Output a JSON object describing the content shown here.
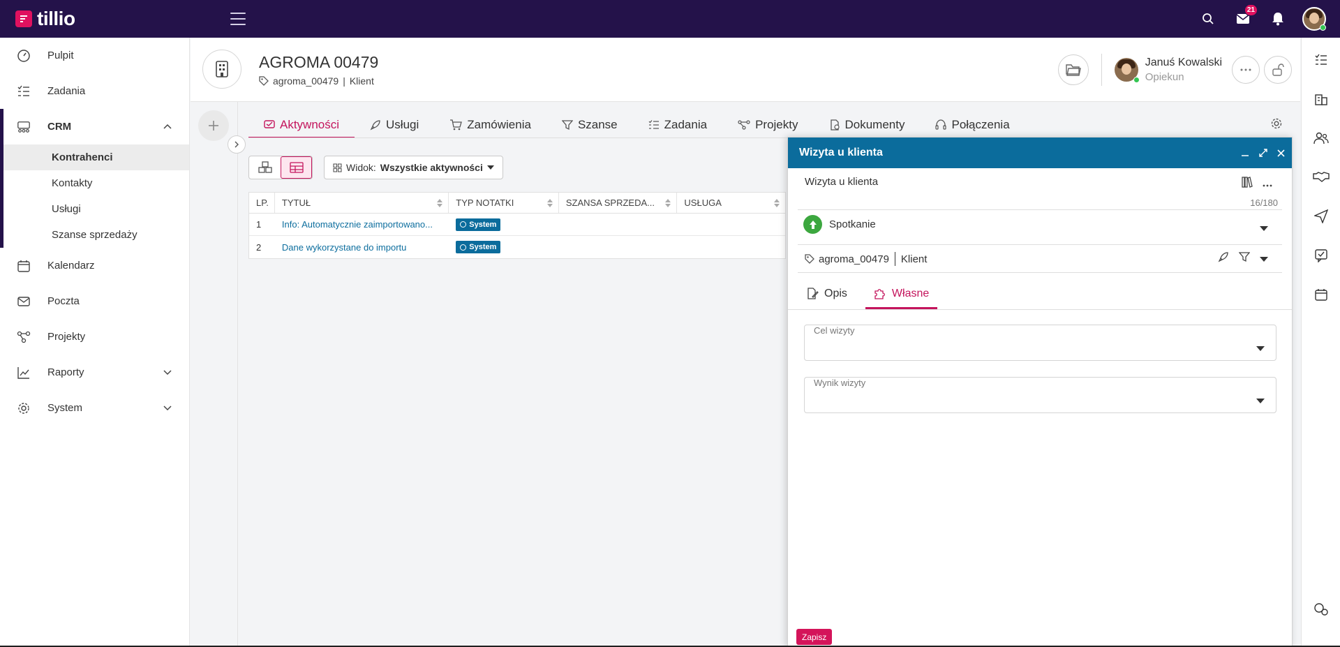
{
  "app": {
    "name": "tillio",
    "notifications_count": "21"
  },
  "sidebar": {
    "items": [
      {
        "label": "Pulpit",
        "icon": "dashboard-icon"
      },
      {
        "label": "Zadania",
        "icon": "tasks-icon"
      },
      {
        "label": "CRM",
        "icon": "crm-icon"
      },
      {
        "label": "Kalendarz",
        "icon": "calendar-icon"
      },
      {
        "label": "Poczta",
        "icon": "mail-icon"
      },
      {
        "label": "Projekty",
        "icon": "projects-icon"
      },
      {
        "label": "Raporty",
        "icon": "reports-icon"
      },
      {
        "label": "System",
        "icon": "gear-icon"
      }
    ],
    "crm_sub": [
      "Kontrahenci",
      "Kontakty",
      "Usługi",
      "Szanse sprzedaży"
    ]
  },
  "header": {
    "title": "AGROMA 00479",
    "tag": "agroma_00479",
    "type": "Klient",
    "owner_name": "Januś Kowalski",
    "owner_role": "Opiekun"
  },
  "tabs": [
    "Aktywności",
    "Usługi",
    "Zamówienia",
    "Szanse",
    "Zadania",
    "Projekty",
    "Dokumenty",
    "Połączenia"
  ],
  "toolbar": {
    "view_prefix": "Widok:",
    "view_value": "Wszystkie aktywności"
  },
  "table": {
    "columns": [
      "LP.",
      "TYTUŁ",
      "TYP NOTATKI",
      "SZANSA SPRZEDA...",
      "USŁUGA"
    ],
    "rows": [
      {
        "lp": "1",
        "title": "Info: Automatycznie zaimportowano...",
        "type": "System"
      },
      {
        "lp": "2",
        "title": "Dane wykorzystane do importu",
        "type": "System"
      }
    ]
  },
  "panel": {
    "header_title": "Wizyta u klienta",
    "title_value": "Wizyta u klienta",
    "counter": "16/180",
    "activity_type": "Spotkanie",
    "tag": "agroma_00479",
    "tag_type": "Klient",
    "tabs": [
      "Opis",
      "Własne"
    ],
    "field_goal_label": "Cel wizyty",
    "field_result_label": "Wynik wizyty",
    "save_label": "Zapisz"
  }
}
